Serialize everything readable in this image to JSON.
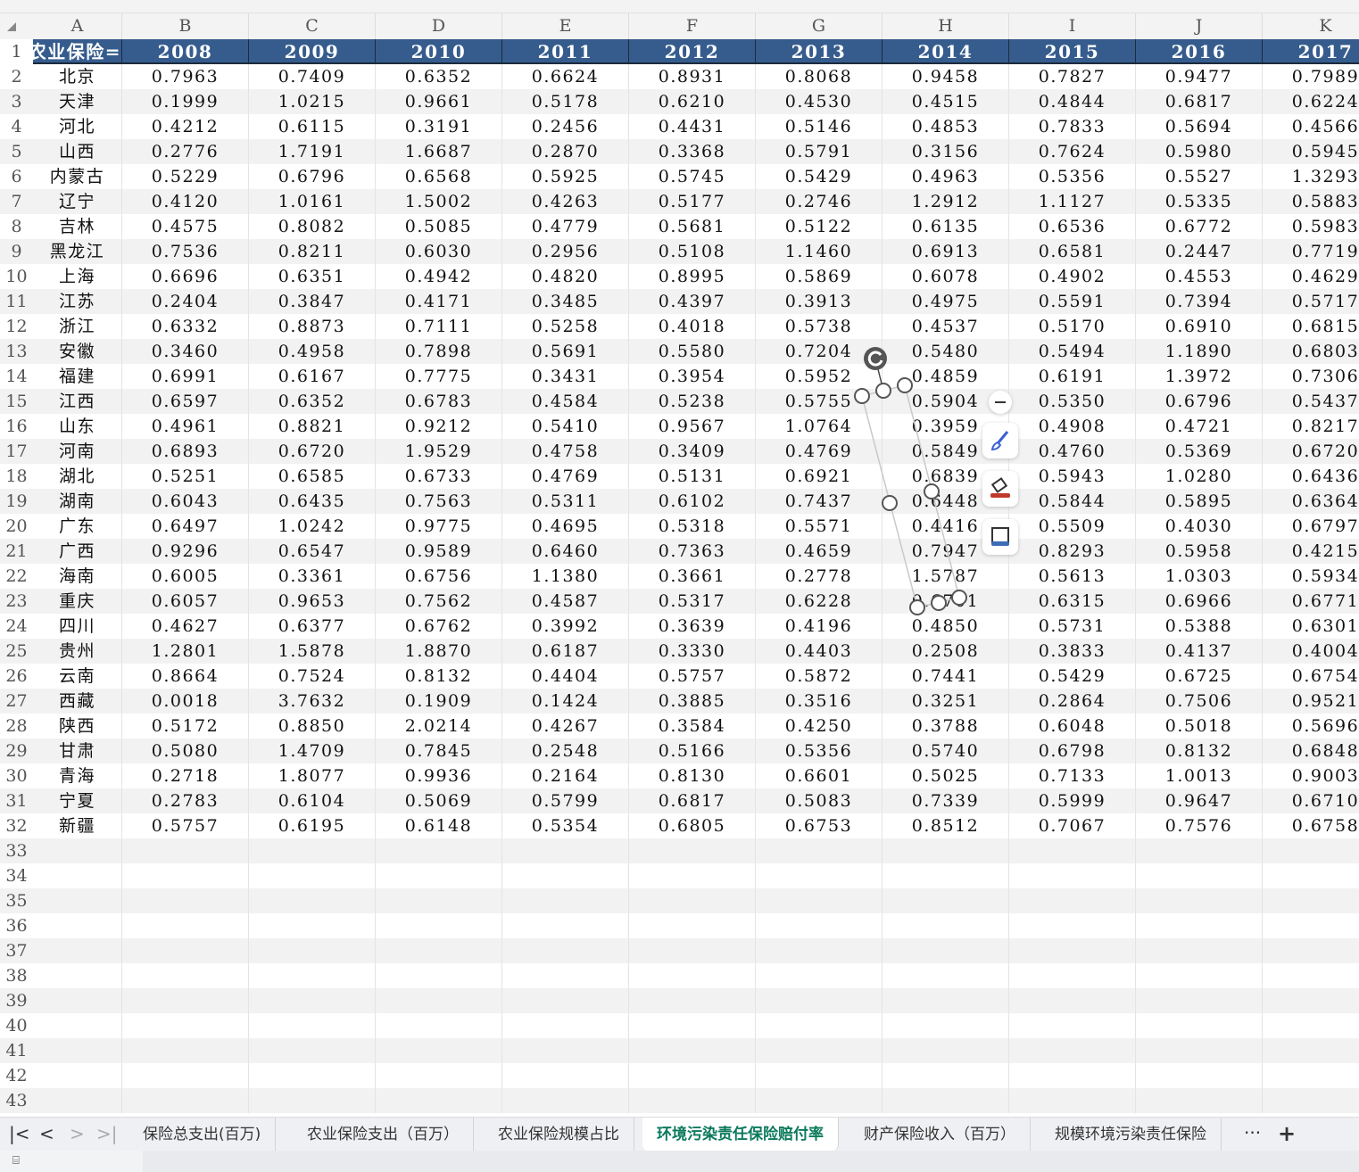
{
  "columns": [
    "A",
    "B",
    "C",
    "D",
    "E",
    "F",
    "G",
    "H",
    "I",
    "J",
    "K"
  ],
  "header_row": [
    "=农业保险",
    "2008",
    "2009",
    "2010",
    "2011",
    "2012",
    "2013",
    "2014",
    "2015",
    "2016",
    "2017"
  ],
  "rows": [
    [
      "北京",
      "0.7963",
      "0.7409",
      "0.6352",
      "0.6624",
      "0.8931",
      "0.8068",
      "0.9458",
      "0.7827",
      "0.9477",
      "0.7989"
    ],
    [
      "天津",
      "0.1999",
      "1.0215",
      "0.9661",
      "0.5178",
      "0.6210",
      "0.4530",
      "0.4515",
      "0.4844",
      "0.6817",
      "0.6224"
    ],
    [
      "河北",
      "0.4212",
      "0.6115",
      "0.3191",
      "0.2456",
      "0.4431",
      "0.5146",
      "0.4853",
      "0.7833",
      "0.5694",
      "0.4566"
    ],
    [
      "山西",
      "0.2776",
      "1.7191",
      "1.6687",
      "0.2870",
      "0.3368",
      "0.5791",
      "0.3156",
      "0.7624",
      "0.5980",
      "0.5945"
    ],
    [
      "内蒙古",
      "0.5229",
      "0.6796",
      "0.6568",
      "0.5925",
      "0.5745",
      "0.5429",
      "0.4963",
      "0.5356",
      "0.5527",
      "1.3293"
    ],
    [
      "辽宁",
      "0.4120",
      "1.0161",
      "1.5002",
      "0.4263",
      "0.5177",
      "0.2746",
      "1.2912",
      "1.1127",
      "0.5335",
      "0.5883"
    ],
    [
      "吉林",
      "0.4575",
      "0.8082",
      "0.5085",
      "0.4779",
      "0.5681",
      "0.5122",
      "0.6135",
      "0.6536",
      "0.6772",
      "0.5983"
    ],
    [
      "黑龙江",
      "0.7536",
      "0.8211",
      "0.6030",
      "0.2956",
      "0.5108",
      "1.1460",
      "0.6913",
      "0.6581",
      "0.2447",
      "0.7719"
    ],
    [
      "上海",
      "0.6696",
      "0.6351",
      "0.4942",
      "0.4820",
      "0.8995",
      "0.5869",
      "0.6078",
      "0.4902",
      "0.4553",
      "0.4629"
    ],
    [
      "江苏",
      "0.2404",
      "0.3847",
      "0.4171",
      "0.3485",
      "0.4397",
      "0.3913",
      "0.4975",
      "0.5591",
      "0.7394",
      "0.5717"
    ],
    [
      "浙江",
      "0.6332",
      "0.8873",
      "0.7111",
      "0.5258",
      "0.4018",
      "0.5738",
      "0.4537",
      "0.5170",
      "0.6910",
      "0.6815"
    ],
    [
      "安徽",
      "0.3460",
      "0.4958",
      "0.7898",
      "0.5691",
      "0.5580",
      "0.7204",
      "0.5480",
      "0.5494",
      "1.1890",
      "0.6803"
    ],
    [
      "福建",
      "0.6991",
      "0.6167",
      "0.7775",
      "0.3431",
      "0.3954",
      "0.5952",
      "0.4859",
      "0.6191",
      "1.3972",
      "0.7306"
    ],
    [
      "江西",
      "0.6597",
      "0.6352",
      "0.6783",
      "0.4584",
      "0.5238",
      "0.5755",
      "0.5904",
      "0.5350",
      "0.6796",
      "0.5437"
    ],
    [
      "山东",
      "0.4961",
      "0.8821",
      "0.9212",
      "0.5410",
      "0.9567",
      "1.0764",
      "0.3959",
      "0.4908",
      "0.4721",
      "0.8217"
    ],
    [
      "河南",
      "0.6893",
      "0.6720",
      "1.9529",
      "0.4758",
      "0.3409",
      "0.4769",
      "0.5849",
      "0.4760",
      "0.5369",
      "0.6720"
    ],
    [
      "湖北",
      "0.5251",
      "0.6585",
      "0.6733",
      "0.4769",
      "0.5131",
      "0.6921",
      "0.6839",
      "0.5943",
      "1.0280",
      "0.6436"
    ],
    [
      "湖南",
      "0.6043",
      "0.6435",
      "0.7563",
      "0.5311",
      "0.6102",
      "0.7437",
      "0.6448",
      "0.5844",
      "0.5895",
      "0.6364"
    ],
    [
      "广东",
      "0.6497",
      "1.0242",
      "0.9775",
      "0.4695",
      "0.5318",
      "0.5571",
      "0.4416",
      "0.5509",
      "0.4030",
      "0.6797"
    ],
    [
      "广西",
      "0.9296",
      "0.6547",
      "0.9589",
      "0.6460",
      "0.7363",
      "0.4659",
      "0.7947",
      "0.8293",
      "0.5958",
      "0.4215"
    ],
    [
      "海南",
      "0.6005",
      "0.3361",
      "0.6756",
      "1.1380",
      "0.3661",
      "0.2778",
      "1.5787",
      "0.5613",
      "1.0303",
      "0.5934"
    ],
    [
      "重庆",
      "0.6057",
      "0.9653",
      "0.7562",
      "0.4587",
      "0.5317",
      "0.6228",
      "0.6701",
      "0.6315",
      "0.6966",
      "0.6771"
    ],
    [
      "四川",
      "0.4627",
      "0.6377",
      "0.6762",
      "0.3992",
      "0.3639",
      "0.4196",
      "0.4850",
      "0.5731",
      "0.5388",
      "0.6301"
    ],
    [
      "贵州",
      "1.2801",
      "1.5878",
      "1.8870",
      "0.6187",
      "0.3330",
      "0.4403",
      "0.2508",
      "0.3833",
      "0.4137",
      "0.4004"
    ],
    [
      "云南",
      "0.8664",
      "0.7524",
      "0.8132",
      "0.4404",
      "0.5757",
      "0.5872",
      "0.7441",
      "0.5429",
      "0.6725",
      "0.6754"
    ],
    [
      "西藏",
      "0.0018",
      "3.7632",
      "0.1909",
      "0.1424",
      "0.3885",
      "0.3516",
      "0.3251",
      "0.2864",
      "0.7506",
      "0.9521"
    ],
    [
      "陕西",
      "0.5172",
      "0.8850",
      "2.0214",
      "0.4267",
      "0.3584",
      "0.4250",
      "0.3788",
      "0.6048",
      "0.5018",
      "0.5696"
    ],
    [
      "甘肃",
      "0.5080",
      "1.4709",
      "0.7845",
      "0.2548",
      "0.5166",
      "0.5356",
      "0.5740",
      "0.6798",
      "0.8132",
      "0.6848"
    ],
    [
      "青海",
      "0.2718",
      "1.8077",
      "0.9936",
      "0.2164",
      "0.8130",
      "0.6601",
      "0.5025",
      "0.7133",
      "1.0013",
      "0.9003"
    ],
    [
      "宁夏",
      "0.2783",
      "0.6104",
      "0.5069",
      "0.5799",
      "0.6817",
      "0.5083",
      "0.7339",
      "0.5999",
      "0.9647",
      "0.6710"
    ],
    [
      "新疆",
      "0.5757",
      "0.6195",
      "0.6148",
      "0.5354",
      "0.6805",
      "0.6753",
      "0.8512",
      "0.7067",
      "0.7576",
      "0.6758"
    ]
  ],
  "total_rows": 43,
  "tabs": [
    "保险总支出(百万)",
    "农业保险支出（百万）",
    "农业保险规模占比",
    "环境污染责任保险赔付率",
    "财产保险收入（百万）",
    "规模环境污染责任保险"
  ],
  "active_tab": 3,
  "tab_more": "···",
  "tab_add": "+",
  "nav": {
    "first": "|<",
    "prev": "<",
    "next": ">",
    "last": ">|"
  },
  "status_icon": "macro-record-icon",
  "accent": "#365c8d"
}
